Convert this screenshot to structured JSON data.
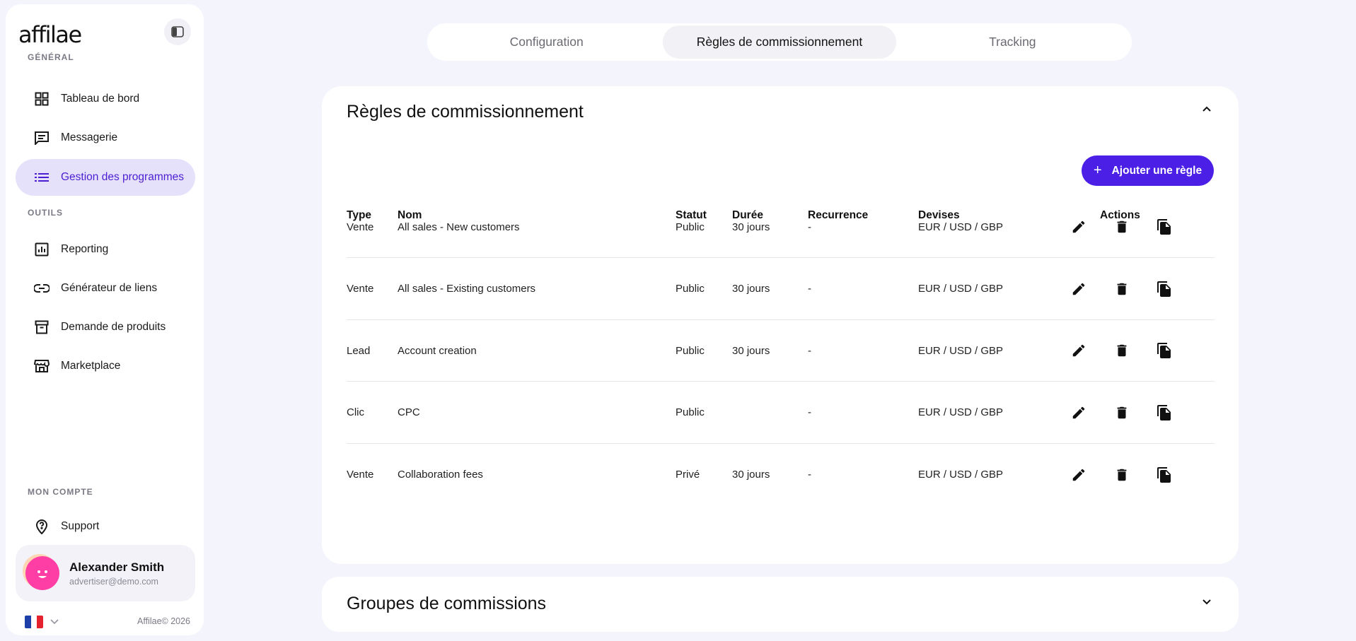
{
  "brand": {
    "logo": "affilae",
    "copyright": "Affilae© 2026"
  },
  "sidebar": {
    "section_general": "GÉNÉRAL",
    "section_tools": "OUTILS",
    "section_account": "MON COMPTE",
    "items": [
      {
        "label": "Tableau de bord",
        "icon": "grid-icon"
      },
      {
        "label": "Messagerie",
        "icon": "message-icon"
      },
      {
        "label": "Gestion des programmes",
        "icon": "list-icon",
        "active": true
      },
      {
        "label": "Reporting",
        "icon": "chart-icon"
      },
      {
        "label": "Générateur de liens",
        "icon": "link-icon"
      },
      {
        "label": "Demande de produits",
        "icon": "archive-icon"
      },
      {
        "label": "Marketplace",
        "icon": "store-icon"
      },
      {
        "label": "Support",
        "icon": "support-icon"
      }
    ]
  },
  "user": {
    "name": "Alexander Smith",
    "email": "advertiser@demo.com"
  },
  "tabs": [
    {
      "label": "Configuration"
    },
    {
      "label": "Règles de commissionnement",
      "active": true
    },
    {
      "label": "Tracking"
    }
  ],
  "rules_card": {
    "title": "Règles de commissionnement",
    "add_button": "Ajouter une règle",
    "headers": {
      "type": "Type",
      "name": "Nom",
      "status": "Statut",
      "duration": "Durée",
      "recurrence": "Recurrence",
      "currencies": "Devises",
      "actions": "Actions"
    },
    "rows": [
      {
        "type": "Vente",
        "name": "All sales - New customers",
        "status": "Public",
        "duration": "30 jours",
        "recurrence": "-",
        "currencies": "EUR / USD / GBP"
      },
      {
        "type": "Vente",
        "name": "All sales - Existing customers",
        "status": "Public",
        "duration": "30 jours",
        "recurrence": "-",
        "currencies": "EUR / USD / GBP"
      },
      {
        "type": "Lead",
        "name": "Account creation",
        "status": "Public",
        "duration": "30 jours",
        "recurrence": "-",
        "currencies": "EUR / USD / GBP"
      },
      {
        "type": "Clic",
        "name": "CPC",
        "status": "Public",
        "duration": "",
        "recurrence": "-",
        "currencies": "EUR / USD / GBP"
      },
      {
        "type": "Vente",
        "name": "Collaboration fees",
        "status": "Privé",
        "duration": "30 jours",
        "recurrence": "-",
        "currencies": "EUR / USD / GBP"
      }
    ]
  },
  "groups_card": {
    "title": "Groupes de commissions"
  },
  "colors": {
    "accent": "#4b1fe6",
    "active_nav_bg": "#e6e1fb",
    "background": "#f4f4fc"
  }
}
